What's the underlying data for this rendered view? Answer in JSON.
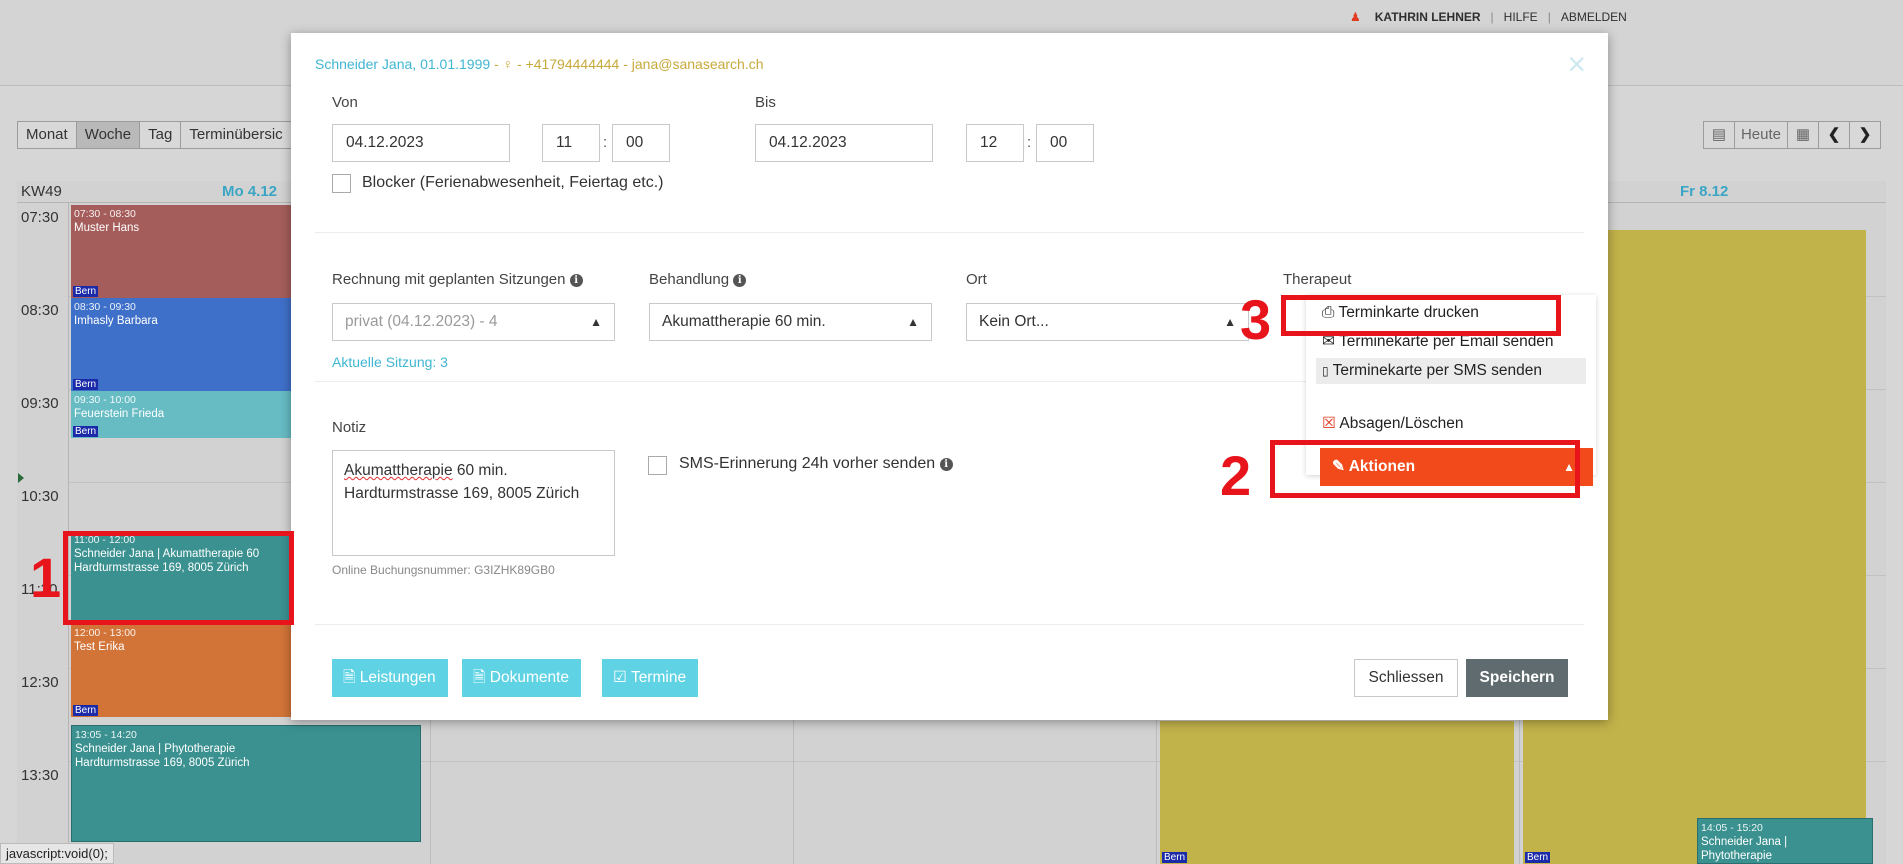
{
  "header": {
    "user_name": "KATHRIN LEHNER",
    "help": "HILFE",
    "logout": "ABMELDEN",
    "sep": "|"
  },
  "views": [
    "Monat",
    "Woche",
    "Tag",
    "Terminübersic"
  ],
  "nav": {
    "today": "Heute"
  },
  "calendar": {
    "week": "KW49",
    "days": [
      "Mo 4.12",
      "Fr 8.12"
    ],
    "times": [
      "07:30",
      "08:30",
      "09:30",
      "10:30",
      "11:30",
      "12:30",
      "13:30"
    ],
    "events": [
      {
        "time": "07:30 - 08:30",
        "title": "Muster Hans",
        "line2": "",
        "loc": "Bern"
      },
      {
        "time": "08:30 - 09:30",
        "title": "Imhasly Barbara",
        "line2": "",
        "loc": "Bern"
      },
      {
        "time": "09:30 - 10:00",
        "title": "Feuerstein Frieda",
        "line2": "",
        "loc": "Bern"
      },
      {
        "time": "11:00 - 12:00",
        "title": "Schneider Jana | Akumattherapie 60",
        "line2": "Hardturmstrasse 169, 8005 Zürich",
        "loc": ""
      },
      {
        "time": "12:00 - 13:00",
        "title": "Test Erika",
        "line2": "",
        "loc": "Bern"
      },
      {
        "time": "13:05 - 14:20",
        "title": "Schneider Jana | Phytotherapie",
        "line2": "Hardturmstrasse 169, 8005 Zürich",
        "loc": ""
      },
      {
        "time": "",
        "title": "",
        "line2": "",
        "loc": "Bern"
      },
      {
        "time": "",
        "title": "",
        "line2": "",
        "loc": "Bern"
      },
      {
        "time": "14:05 - 15:20",
        "title": "Schneider Jana |",
        "line2": "Phytotherapie",
        "loc": ""
      }
    ]
  },
  "statusbar": "javascript:void(0);",
  "modal": {
    "title_name": "Schneider Jana, 01.01.1999",
    "title_rest": " - ♀ - +41794444444 - jana@sanasearch.ch",
    "close": "×",
    "von_label": "Von",
    "bis_label": "Bis",
    "von_date": "04.12.2023",
    "von_hour": "11",
    "von_min": "00",
    "bis_date": "04.12.2023",
    "bis_hour": "12",
    "bis_min": "00",
    "colon": ":",
    "blocker_label": "Blocker (Ferienabwesenheit, Feiertag etc.)",
    "rechnung_label": "Rechnung mit geplanten Sitzungen",
    "rechnung_value": "privat (04.12.2023) - 4",
    "behandlung_label": "Behandlung",
    "behandlung_value": "Akumattherapie 60 min.",
    "ort_label": "Ort",
    "ort_value": "Kein Ort...",
    "therapeut_label": "Therapeut",
    "aktuelle_sitzung": "Aktuelle Sitzung: 3",
    "notiz_label": "Notiz",
    "notiz_line1_word": "Akumattherapie",
    "notiz_line1_rest": " 60 min.",
    "notiz_line2": "Hardturmstrasse 169, 8005 Zürich",
    "sms_label": "SMS-Erinnerung 24h vorher senden",
    "buchungsnummer": "Online Buchungsnummer: G3IZHK89GB0",
    "buttons": {
      "leistungen": "Leistungen",
      "dokumente": "Dokumente",
      "termine": "Termine",
      "schliessen": "Schliessen",
      "speichern": "Speichern"
    },
    "actions_menu": {
      "print": "Terminkarte drucken",
      "email": "Terminekarte per Email senden",
      "sms": "Terminekarte per SMS senden",
      "cancel": "Absagen/Löschen",
      "toggle": "Aktionen"
    }
  },
  "annotations": [
    "1",
    "2",
    "3"
  ],
  "colors": {
    "accent_cyan": "#3fb6d2",
    "action_orange": "#f24a1a",
    "annotation_red": "#e8141c",
    "save_gray": "#5f6b6e"
  }
}
